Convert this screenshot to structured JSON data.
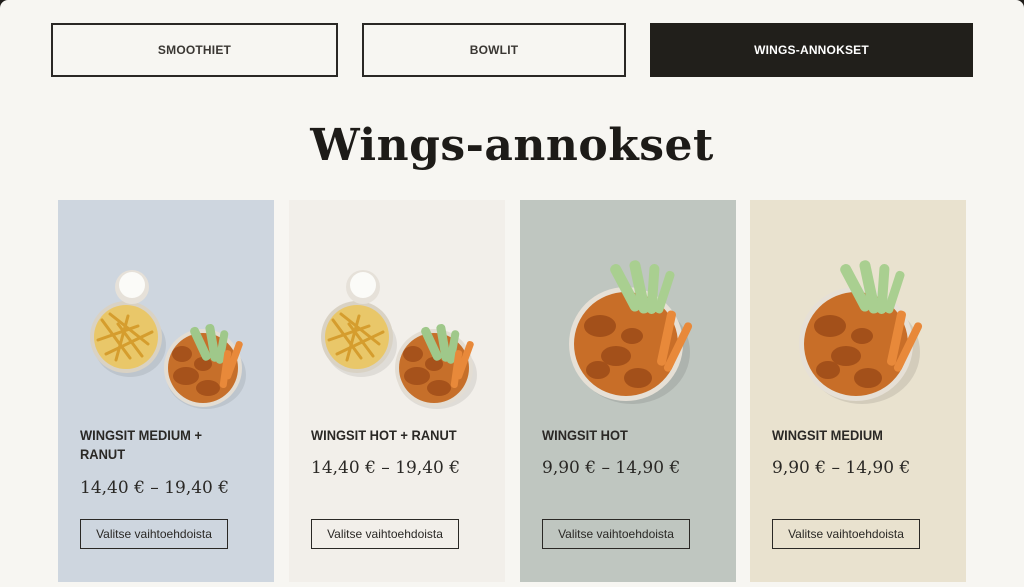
{
  "tabs": [
    {
      "label": "SMOOTHIET",
      "active": false
    },
    {
      "label": "BOWLIT",
      "active": false
    },
    {
      "label": "WINGS-ANNOKSET",
      "active": true
    }
  ],
  "section": {
    "title": "Wings-annokset"
  },
  "products": [
    {
      "name": "WINGSIT MEDIUM + RANUT",
      "price": "14,40 € – 19,40 €",
      "button": "Valitse vaihtoehdoista",
      "bg": "#ced6df",
      "image": "fries-and-wings-plate"
    },
    {
      "name": "WINGSIT HOT + RANUT",
      "price": "14,40 € – 19,40 €",
      "button": "Valitse vaihtoehdoista",
      "bg": "#f2efea",
      "image": "fries-and-wings-plate"
    },
    {
      "name": "WINGSIT HOT",
      "price": "9,90 € – 14,90 €",
      "button": "Valitse vaihtoehdoista",
      "bg": "#bfc6c0",
      "image": "wings-bowl"
    },
    {
      "name": "WINGSIT MEDIUM",
      "price": "9,90 € – 14,90 €",
      "button": "Valitse vaihtoehdoista",
      "bg": "#e9e2cf",
      "image": "wings-bowl"
    }
  ]
}
